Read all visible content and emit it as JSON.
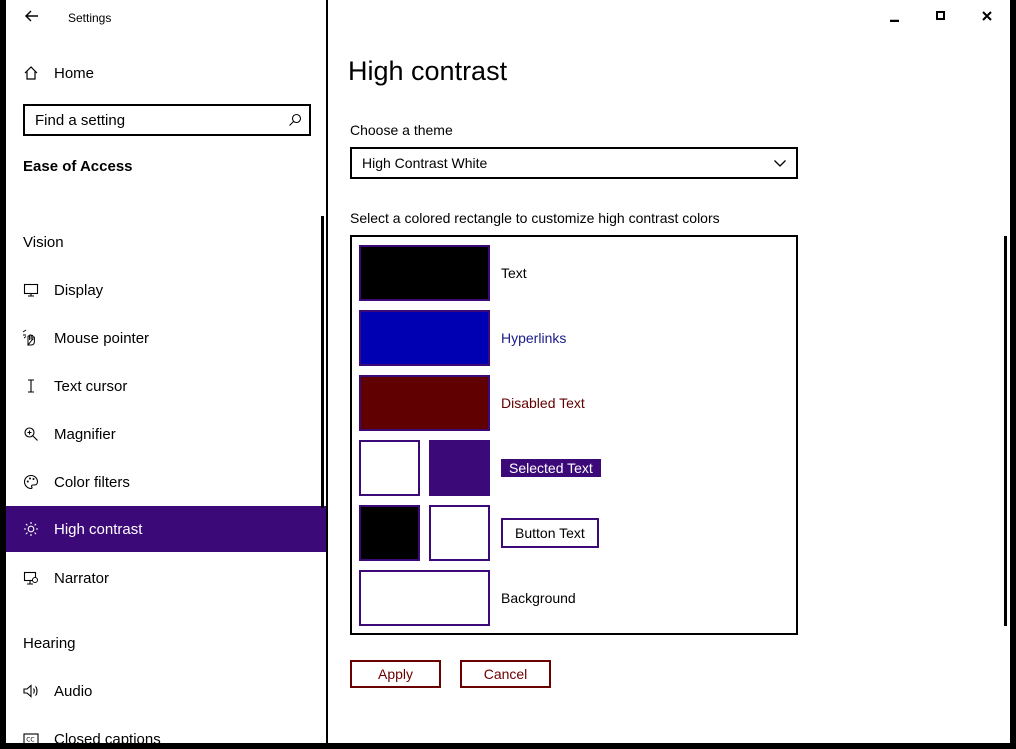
{
  "window": {
    "title": "Settings",
    "caption_buttons": [
      "minimize-icon",
      "maximize-icon",
      "close-icon"
    ]
  },
  "sidebar": {
    "home_label": "Home",
    "search": {
      "placeholder": "Find a setting",
      "icon": "search-icon"
    },
    "group_title": "Ease of Access",
    "vision_heading": "Vision",
    "items": [
      {
        "label": "Display",
        "icon": "display-icon"
      },
      {
        "label": "Mouse pointer",
        "icon": "mouse-pointer-icon"
      },
      {
        "label": "Text cursor",
        "icon": "text-cursor-icon"
      },
      {
        "label": "Magnifier",
        "icon": "magnifier-icon"
      },
      {
        "label": "Color filters",
        "icon": "color-filters-icon"
      },
      {
        "label": "High contrast",
        "icon": "high-contrast-icon",
        "active": true
      },
      {
        "label": "Narrator",
        "icon": "narrator-icon"
      }
    ],
    "hearing_heading": "Hearing",
    "hearing_items": [
      {
        "label": "Audio",
        "icon": "audio-icon"
      },
      {
        "label": "Closed captions",
        "icon": "closed-captions-icon"
      }
    ]
  },
  "main": {
    "title": "High contrast",
    "theme_label": "Choose a theme",
    "theme_value": "High Contrast White",
    "customize_label": "Select a colored rectangle to customize high contrast colors",
    "colors": {
      "text": {
        "label": "Text",
        "swatch": "#000000"
      },
      "hyperlinks": {
        "label": "Hyperlinks",
        "swatch": "#0000b3",
        "text_color": "#1a1a8c"
      },
      "disabled_text": {
        "label": "Disabled Text",
        "swatch": "#600000",
        "text_color": "#600000"
      },
      "selected_text": {
        "label": "Selected Text",
        "swatch_fg": "#ffffff",
        "swatch_bg": "#3c0a78"
      },
      "button_text": {
        "label": "Button Text",
        "swatch_fg": "#000000",
        "swatch_bg": "#ffffff"
      },
      "background": {
        "label": "Background",
        "swatch": "#ffffff"
      }
    },
    "apply_label": "Apply",
    "cancel_label": "Cancel"
  },
  "accent_color": "#3c0a78"
}
